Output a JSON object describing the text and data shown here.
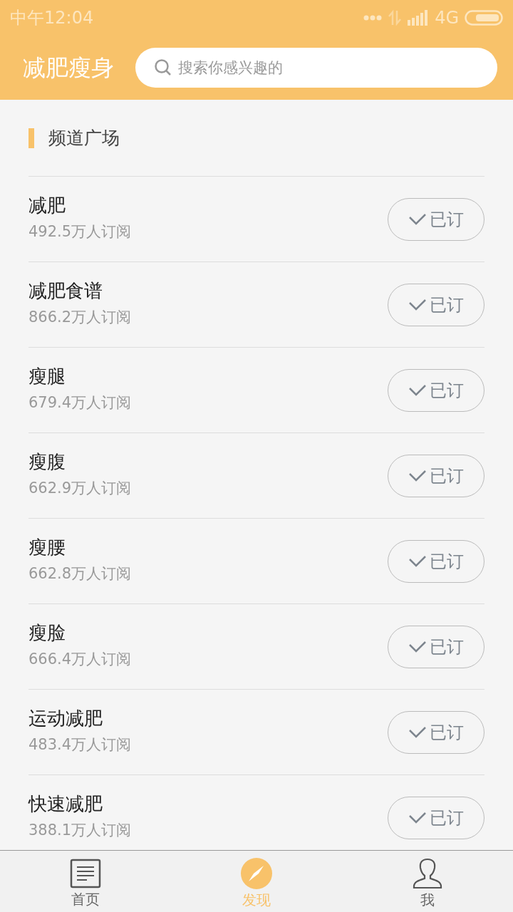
{
  "status_bar": {
    "time": "中午12:04",
    "network": "4G"
  },
  "header": {
    "title": "减肥瘦身",
    "search": {
      "placeholder": "搜索你感兴趣的"
    }
  },
  "section": {
    "title": "频道广场"
  },
  "channels": [
    {
      "name": "减肥",
      "subscribers": "492.5万人订阅",
      "button": "已订",
      "subscribed": true
    },
    {
      "name": "减肥食谱",
      "subscribers": "866.2万人订阅",
      "button": "已订",
      "subscribed": true
    },
    {
      "name": "瘦腿",
      "subscribers": "679.4万人订阅",
      "button": "已订",
      "subscribed": true
    },
    {
      "name": "瘦腹",
      "subscribers": "662.9万人订阅",
      "button": "已订",
      "subscribed": true
    },
    {
      "name": "瘦腰",
      "subscribers": "662.8万人订阅",
      "button": "已订",
      "subscribed": true
    },
    {
      "name": "瘦脸",
      "subscribers": "666.4万人订阅",
      "button": "已订",
      "subscribed": true
    },
    {
      "name": "运动减肥",
      "subscribers": "483.4万人订阅",
      "button": "已订",
      "subscribed": true
    },
    {
      "name": "快速减肥",
      "subscribers": "388.1万人订阅",
      "button": "已订",
      "subscribed": true
    }
  ],
  "tabs": [
    {
      "label": "首页",
      "kind": "home",
      "selected": false
    },
    {
      "label": "发现",
      "kind": "discover",
      "selected": true
    },
    {
      "label": "我",
      "kind": "me",
      "selected": false
    }
  ]
}
